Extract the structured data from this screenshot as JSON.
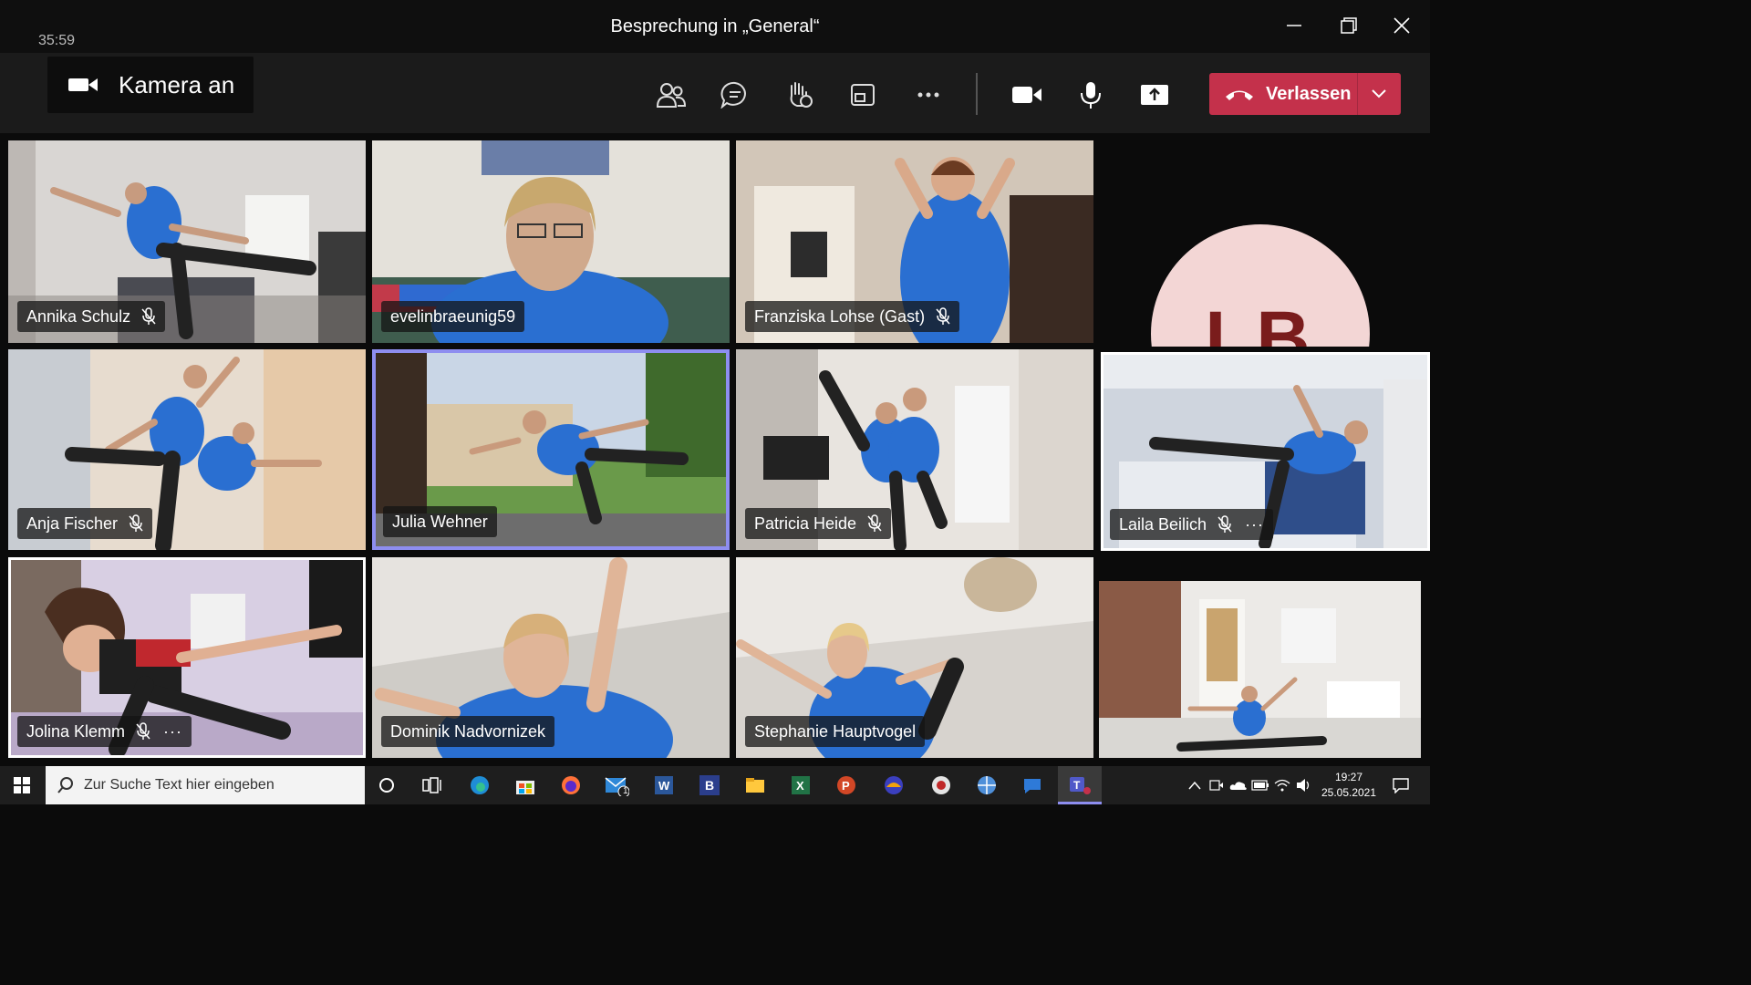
{
  "window": {
    "title": "Besprechung in „General“"
  },
  "toolbar": {
    "timer": "35:59",
    "tooltip": "Kamera an",
    "buttons": [
      "participants-icon",
      "chat-icon",
      "raise-hand-icon",
      "rooms-icon",
      "more-icon",
      "camera-icon",
      "mic-icon",
      "share-icon"
    ],
    "leave_label": "Verlassen"
  },
  "participants": [
    {
      "name": "Annika Schulz",
      "muted": true
    },
    {
      "name": "evelinbraeunig59",
      "muted": false
    },
    {
      "name": "Franziska Lohse (Gast)",
      "muted": true
    },
    {
      "name": "LB",
      "muted": false
    },
    {
      "name": "Anja Fischer",
      "muted": true
    },
    {
      "name": "Julia Wehner",
      "muted": false
    },
    {
      "name": "Patricia Heide",
      "muted": true
    },
    {
      "name": "Laila Beilich",
      "muted": true,
      "more": "···"
    },
    {
      "name": "Jolina Klemm",
      "muted": true,
      "more": "···"
    },
    {
      "name": "Dominik Nadvornizek",
      "muted": false
    },
    {
      "name": "Stephanie Hauptvogel",
      "muted": false
    }
  ],
  "taskbar": {
    "search_placeholder": "Zur Suche Text hier eingeben",
    "time": "19:27",
    "date": "25.05.2021",
    "mail_badge": "1",
    "word_letter": "B"
  },
  "colors": {
    "accent": "#8e8ef0",
    "leave": "#c4314b",
    "shirt": "#2a6fd1"
  }
}
